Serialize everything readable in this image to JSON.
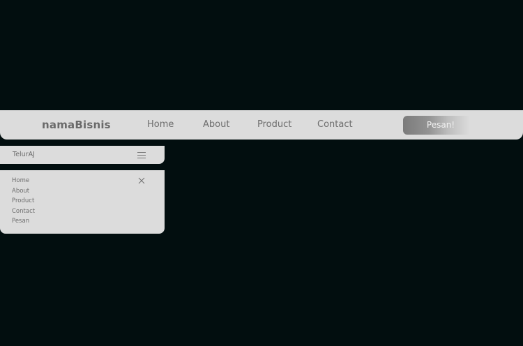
{
  "navbar": {
    "brand": "namaBisnis",
    "links": [
      "Home",
      "About",
      "Product",
      "Contact"
    ],
    "order_button": "Pesan!"
  },
  "mobile_bar": {
    "brand": "TelurAJ",
    "menu_icon": "hamburger-menu-icon"
  },
  "mobile_menu": {
    "close_icon": "close-icon",
    "links": [
      "Home",
      "About",
      "Product",
      "Contact",
      "Pesan"
    ]
  },
  "colors": {
    "background": "#020e0f",
    "bar": "#dcdcdc",
    "text": "#6d6d6d",
    "button_start": "#7b7b7b"
  }
}
